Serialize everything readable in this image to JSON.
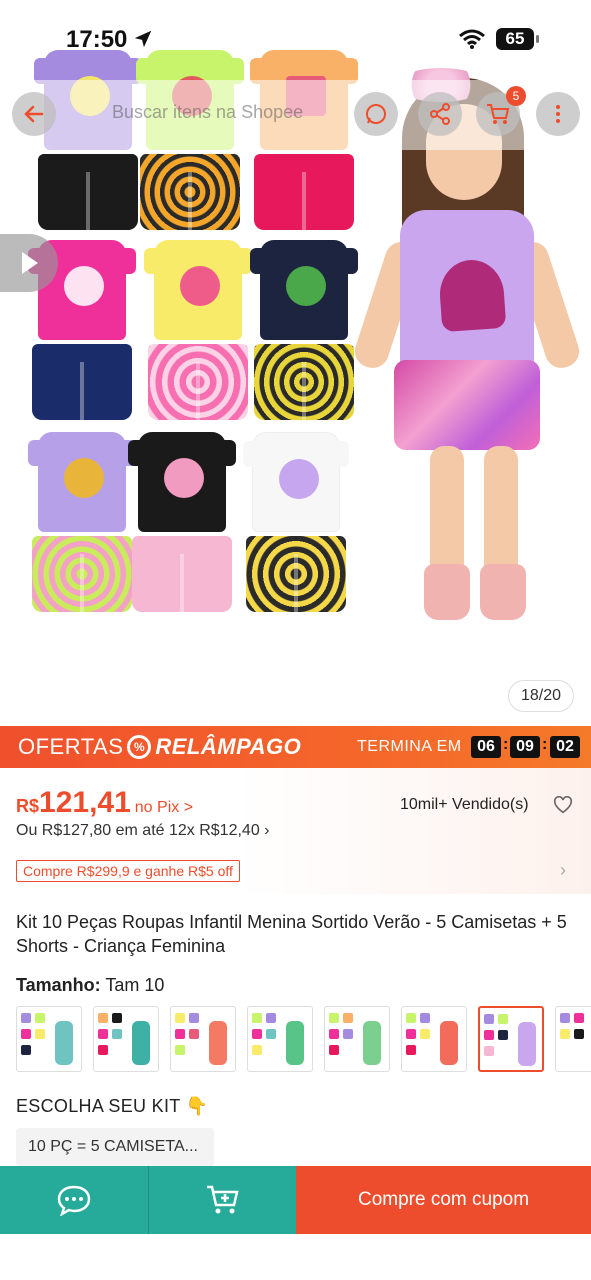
{
  "status_bar": {
    "time": "17:50",
    "battery": "65"
  },
  "nav": {
    "search_placeholder": "Buscar itens na Shopee",
    "cart_count": "5"
  },
  "gallery": {
    "counter": "18/20"
  },
  "flash_sale": {
    "label_left": "OFERTAS",
    "label_right": "RELÂMPAGO",
    "ends_label": "TERMINA EM",
    "hours": "06",
    "minutes": "09",
    "seconds": "02"
  },
  "price": {
    "currency": "R$",
    "amount": "121,41",
    "pix_label": "no Pix >",
    "installment": "Ou R$127,80 em até 12x R$12,40 ›",
    "sold": "10mil+ Vendido(s)"
  },
  "coupon": {
    "text": "Compre R$299,9 e ganhe R$5 off"
  },
  "product": {
    "title": "Kit 10 Peças Roupas Infantil Menina Sortido Verão - 5 Camisetas + 5 Shorts - Criança Feminina"
  },
  "variation": {
    "size_label": "Tamanho:",
    "size_value": "Tam 10"
  },
  "kit": {
    "label": "ESCOLHA SEU KIT 👇",
    "option": "10 PÇ = 5 CAMISETA..."
  },
  "actions": {
    "buy_label": "Compre com cupom"
  },
  "colors": {
    "accent": "#ee4d2d",
    "teal": "#26aa99"
  }
}
